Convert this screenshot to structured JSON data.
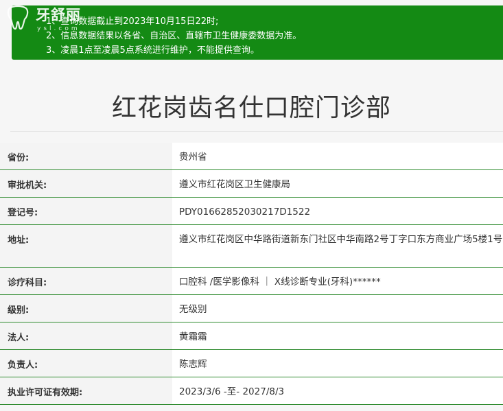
{
  "notice": {
    "lines": [
      "1、查询数据截止到2023年10月15日22时;",
      "2、信息数据结果以各省、自治区、直辖市卫生健康委数据为准。",
      "3、凌晨1点至凌晨5点系统进行维护，不能提供查询。"
    ]
  },
  "watermark": {
    "text": "牙舒丽",
    "sub": "ysl.com"
  },
  "page": {
    "title": "红花岗齿名仕口腔门诊部"
  },
  "details": [
    {
      "label": "省份:",
      "value": "贵州省"
    },
    {
      "label": "审批机关:",
      "value": "遵义市红花岗区卫生健康局"
    },
    {
      "label": "登记号:",
      "value": "PDY01662852030217D1522"
    },
    {
      "label": "地址:",
      "value": "遵义市红花岗区中华路街道新东门社区中华南路2号丁字口东方商业广场5楼1号"
    },
    {
      "label": "诊疗科目:",
      "value": "口腔科 /医学影像科 ｜ X线诊断专业(牙科)******"
    },
    {
      "label": "级别:",
      "value": "无级别"
    },
    {
      "label": "法人:",
      "value": "黄霜霜"
    },
    {
      "label": "负责人:",
      "value": "陈志辉"
    },
    {
      "label": "执业许可证有效期:",
      "value": "2023/3/6 -至- 2027/8/3"
    }
  ]
}
